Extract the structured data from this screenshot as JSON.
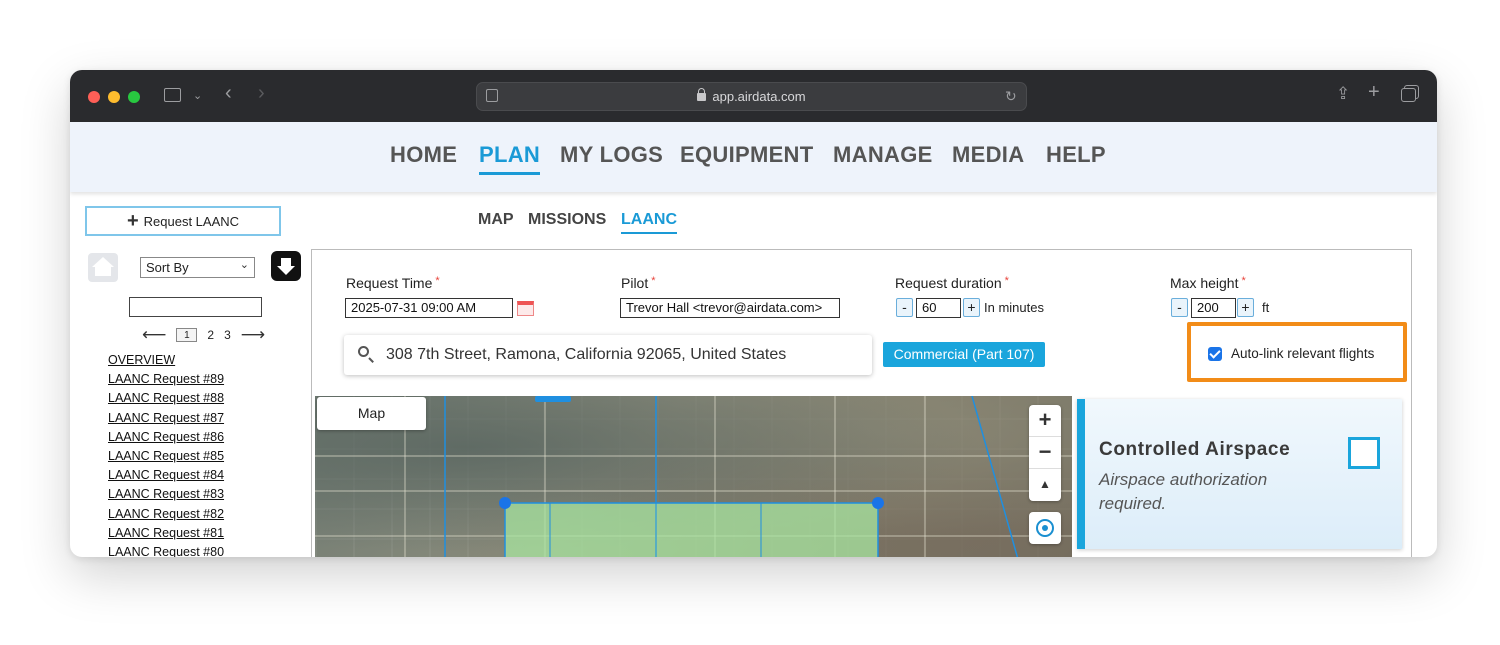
{
  "browser": {
    "url": "app.airdata.com"
  },
  "nav": {
    "items": [
      "HOME",
      "PLAN",
      "MY LOGS",
      "EQUIPMENT",
      "MANAGE",
      "MEDIA",
      "HELP"
    ],
    "active": "PLAN"
  },
  "sidebar": {
    "request_button": "Request LAANC",
    "sort_label": "Sort By",
    "filter_value": "",
    "pager": {
      "current": "1",
      "pages": [
        "2",
        "3"
      ]
    },
    "overview": "OVERVIEW",
    "requests": [
      "LAANC Request #89",
      "LAANC Request #88",
      "LAANC Request #87",
      "LAANC Request #86",
      "LAANC Request #85",
      "LAANC Request #84",
      "LAANC Request #83",
      "LAANC Request #82",
      "LAANC Request #81",
      "LAANC Request #80"
    ]
  },
  "subtabs": {
    "items": [
      "MAP",
      "MISSIONS",
      "LAANC"
    ],
    "active": "LAANC"
  },
  "form": {
    "request_time": {
      "label": "Request Time",
      "value": "2025-07-31 09:00 AM"
    },
    "pilot": {
      "label": "Pilot",
      "value": "Trevor Hall <trevor@airdata.com>"
    },
    "duration": {
      "label": "Request duration",
      "value": "60",
      "unit": "In minutes"
    },
    "max_height": {
      "label": "Max height",
      "value": "200",
      "unit": "ft"
    },
    "address": "308 7th Street, Ramona, California 92065, United States",
    "operation_type": "Commercial (Part 107)",
    "autolink": {
      "label": "Auto-link relevant flights",
      "checked": true
    }
  },
  "map": {
    "type_button": "Map",
    "zoom_in": "+",
    "zoom_out": "−",
    "compass": "▲"
  },
  "airspace": {
    "title": "Controlled Airspace",
    "subtitle": "Airspace authorization required."
  },
  "colors": {
    "accent": "#1a9ad6",
    "highlight": "#f28c18",
    "area_fill": "#a8e6a0"
  }
}
